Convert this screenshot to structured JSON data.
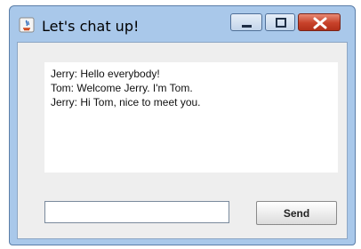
{
  "window": {
    "title": "Let's chat up!",
    "icon": "java-app-icon"
  },
  "title_buttons": [
    "minimize-icon",
    "maximize-icon",
    "close-icon"
  ],
  "chat": {
    "lines": [
      "Jerry: Hello everybody!",
      "Tom: Welcome Jerry. I'm Tom.",
      "Jerry: Hi Tom, nice to meet you."
    ]
  },
  "composer": {
    "input_value": "",
    "send_label": "Send"
  },
  "colors": {
    "frame": "#a9c8ea",
    "client_bg": "#eeeeee",
    "close_button": "#c7412a"
  }
}
